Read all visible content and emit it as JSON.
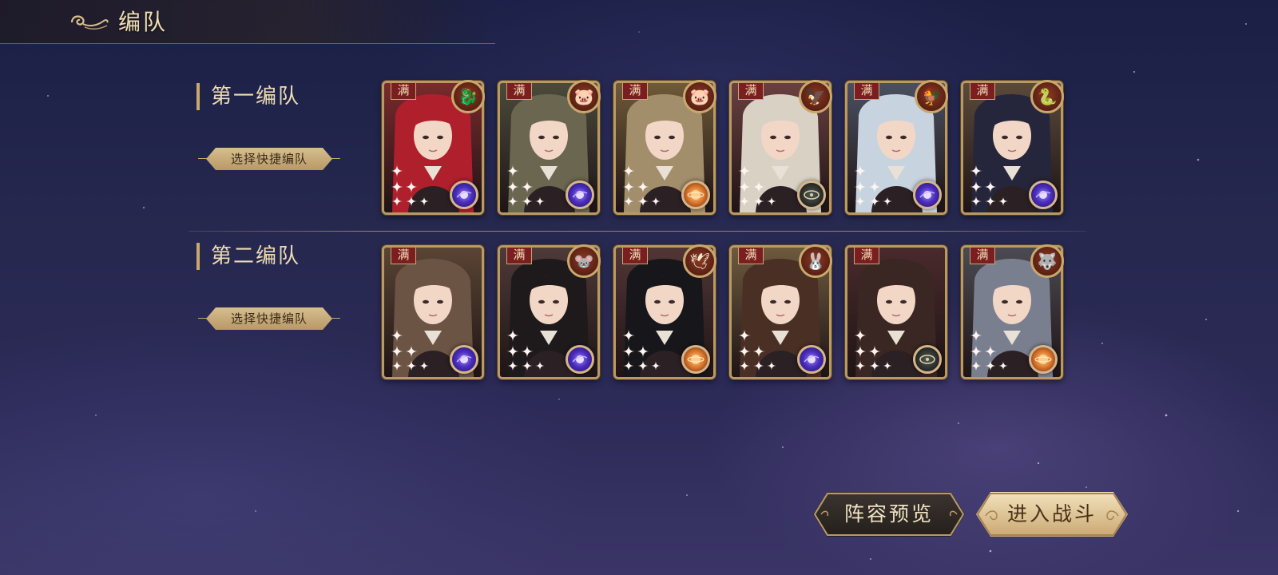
{
  "header": {
    "title": "编队",
    "icon": "cloud-swirl-icon"
  },
  "teams": [
    {
      "label": "第一编队",
      "quick_button": "选择快捷编队",
      "cards": [
        {
          "tag": "满",
          "pet": "dragon-pet-icon",
          "element": "galaxy",
          "hair": "#b0202c",
          "bg": "#7a2a2c"
        },
        {
          "tag": "满",
          "pet": "pig-pet-icon",
          "element": "galaxy",
          "hair": "#6a6650",
          "bg": "#4b4a3a"
        },
        {
          "tag": "满",
          "pet": "pig-pet-icon",
          "element": "sun",
          "hair": "#a38e6c",
          "bg": "#6f5a38"
        },
        {
          "tag": "满",
          "pet": "eagle-pet-icon",
          "element": "ring",
          "hair": "#d9d2c4",
          "bg": "#6a4040"
        },
        {
          "tag": "满",
          "pet": "rooster-pet-icon",
          "element": "galaxy",
          "hair": "#c7d3df",
          "bg": "#4a5060"
        },
        {
          "tag": "满",
          "pet": "white-snake-pet-icon",
          "element": "galaxy",
          "hair": "#25263c",
          "bg": "#5b4a3a"
        }
      ]
    },
    {
      "label": "第二编队",
      "quick_button": "选择快捷编队",
      "cards": [
        {
          "tag": "满",
          "pet": "none",
          "element": "galaxy",
          "hair": "#6b5444",
          "bg": "#5a4434"
        },
        {
          "tag": "满",
          "pet": "mouse-pet-icon",
          "element": "galaxy",
          "hair": "#1e1a1c",
          "bg": "#4e3a38"
        },
        {
          "tag": "满",
          "pet": "white-bird-pet-icon",
          "element": "sun",
          "hair": "#17161a",
          "bg": "#523636"
        },
        {
          "tag": "满",
          "pet": "rabbit-pet-icon",
          "element": "galaxy",
          "hair": "#4a3024",
          "bg": "#6d5a3e"
        },
        {
          "tag": "满",
          "pet": "none",
          "element": "ring",
          "hair": "#3a2622",
          "bg": "#4a2a2c"
        },
        {
          "tag": "满",
          "pet": "wolf-pet-icon",
          "element": "sun",
          "hair": "#7a7f90",
          "bg": "#4b4a52"
        }
      ]
    }
  ],
  "buttons": {
    "preview": "阵容预览",
    "battle": "进入战斗"
  }
}
